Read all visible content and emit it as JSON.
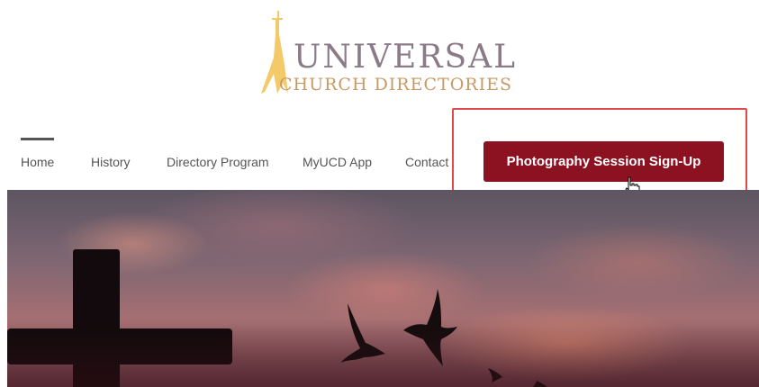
{
  "logo": {
    "line1": "UNIVERSAL",
    "line2": "CHURCH DIRECTORIES"
  },
  "nav": {
    "items": [
      {
        "label": "Home"
      },
      {
        "label": "History"
      },
      {
        "label": "Directory Program"
      },
      {
        "label": "MyUCD App"
      },
      {
        "label": "Contact"
      }
    ],
    "cta_label": "Photography Session Sign-Up"
  },
  "colors": {
    "cta": "#8c1222",
    "highlight": "#e24a4a",
    "logo_gold": "#c89a63",
    "logo_text": "#8b7b88"
  }
}
